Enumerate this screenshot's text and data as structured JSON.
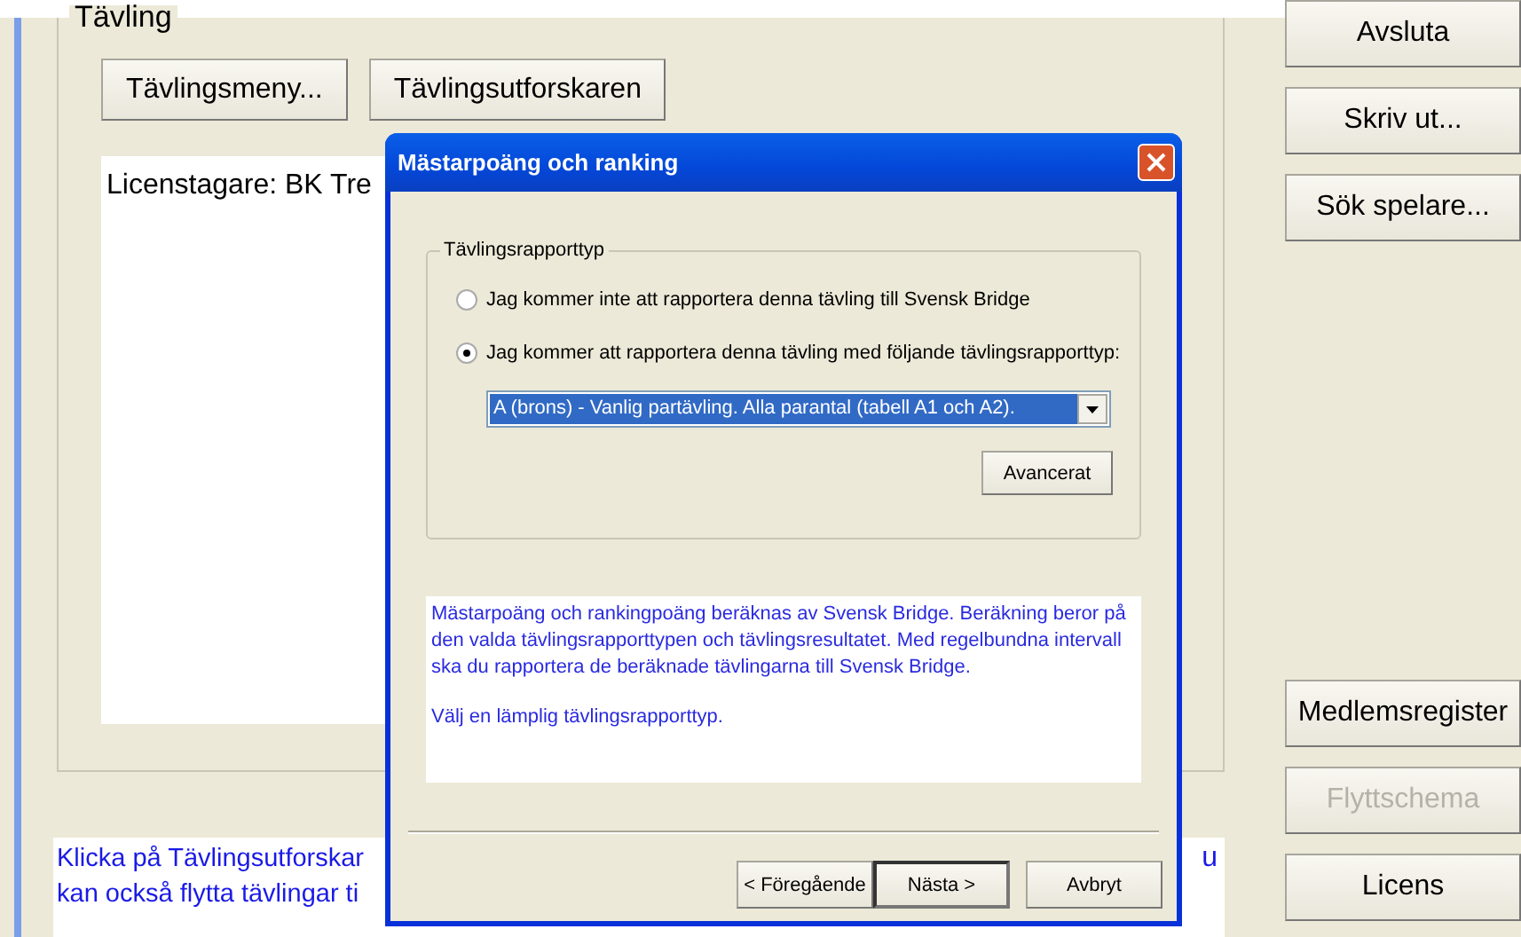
{
  "main": {
    "group_title": "Tävling",
    "buttons": [
      "Tävlingsmeny...",
      "Tävlingsutforskaren"
    ],
    "license_text": "Licenstagare: BK Tre",
    "info_lines": [
      "Klicka på Tävlingsutforskar",
      "kan också flytta tävlingar ti"
    ],
    "info_tail": "u"
  },
  "side_buttons": [
    {
      "label": "Avsluta",
      "disabled": false
    },
    {
      "label": "Skriv ut...",
      "disabled": false
    },
    {
      "label": "Sök spelare...",
      "disabled": false
    },
    {
      "label": "Medlemsregister",
      "disabled": false
    },
    {
      "label": "Flyttschema",
      "disabled": true
    },
    {
      "label": "Licens",
      "disabled": false
    }
  ],
  "dialog": {
    "title": "Mästarpoäng och ranking",
    "group_title": "Tävlingsrapporttyp",
    "radios": [
      {
        "label": "Jag kommer inte att rapportera denna tävling till Svensk Bridge",
        "selected": false
      },
      {
        "label": "Jag kommer att rapportera denna tävling med följande tävlingsrapporttyp:",
        "selected": true
      }
    ],
    "dropdown": {
      "value": "A (brons) - Vanlig partävling. Alla parantal (tabell A1 och A2)."
    },
    "advanced_button": "Avancerat",
    "info": [
      "Mästarpoäng och rankingpoäng beräknas av Svensk Bridge. Beräkning beror på den valda tävlingsrapporttypen och tävlingsresultatet. Med regelbundna intervall ska du rapportera de beräknade tävlingarna till Svensk Bridge.",
      "Välj en lämplig tävlingsrapporttyp."
    ],
    "buttons": [
      {
        "label": "< Föregående",
        "default": false
      },
      {
        "label": "Nästa >",
        "default": true
      },
      {
        "label": "Avbryt",
        "default": false
      }
    ]
  }
}
